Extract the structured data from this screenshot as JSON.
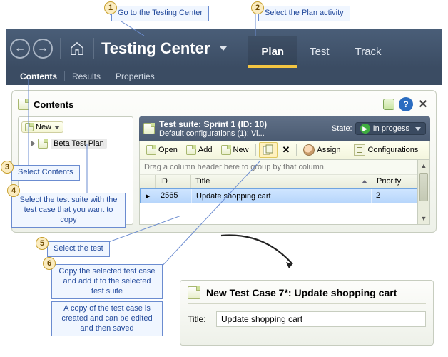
{
  "annotations": {
    "a1": "Go to the Testing Center",
    "a2": "Select the Plan activity",
    "a3": "Select Contents",
    "a4": "Select the test suite with the test case that you want to copy",
    "a5": "Select the test",
    "a6": "Copy the selected test case and add it to the selected test suite",
    "a7": "A copy of the test case is created and can be edited and then saved"
  },
  "ribbon": {
    "title": "Testing Center",
    "tabs": [
      {
        "label": "Plan",
        "active": true
      },
      {
        "label": "Test",
        "active": false
      },
      {
        "label": "Track",
        "active": false
      }
    ]
  },
  "subtabs": [
    {
      "label": "Contents",
      "active": true
    },
    {
      "label": "Results",
      "active": false
    },
    {
      "label": "Properties",
      "active": false
    }
  ],
  "panel": {
    "title": "Contents",
    "tree": {
      "new_button": "New",
      "items": [
        {
          "label": "Beta Test Plan"
        }
      ]
    },
    "suite": {
      "title": "Test suite:  Sprint 1 (ID: 10)",
      "subtitle": "Default configurations (1): Vi...",
      "state_label": "State:",
      "state_value": "In progess"
    },
    "toolbar": {
      "open": "Open",
      "add": "Add",
      "new": "New",
      "delete_tip": "Delete",
      "assign": "Assign",
      "config": "Configurations"
    },
    "grid": {
      "group_hint": "Drag a column header here to group by that column.",
      "columns": {
        "id": "ID",
        "title": "Title",
        "priority": "Priority"
      },
      "rows": [
        {
          "id": "2565",
          "title": "Update shopping cart",
          "priority": "2"
        }
      ]
    }
  },
  "newcase": {
    "heading": "New Test Case 7*: Update shopping cart",
    "title_label": "Title:",
    "title_value": "Update shopping cart"
  }
}
